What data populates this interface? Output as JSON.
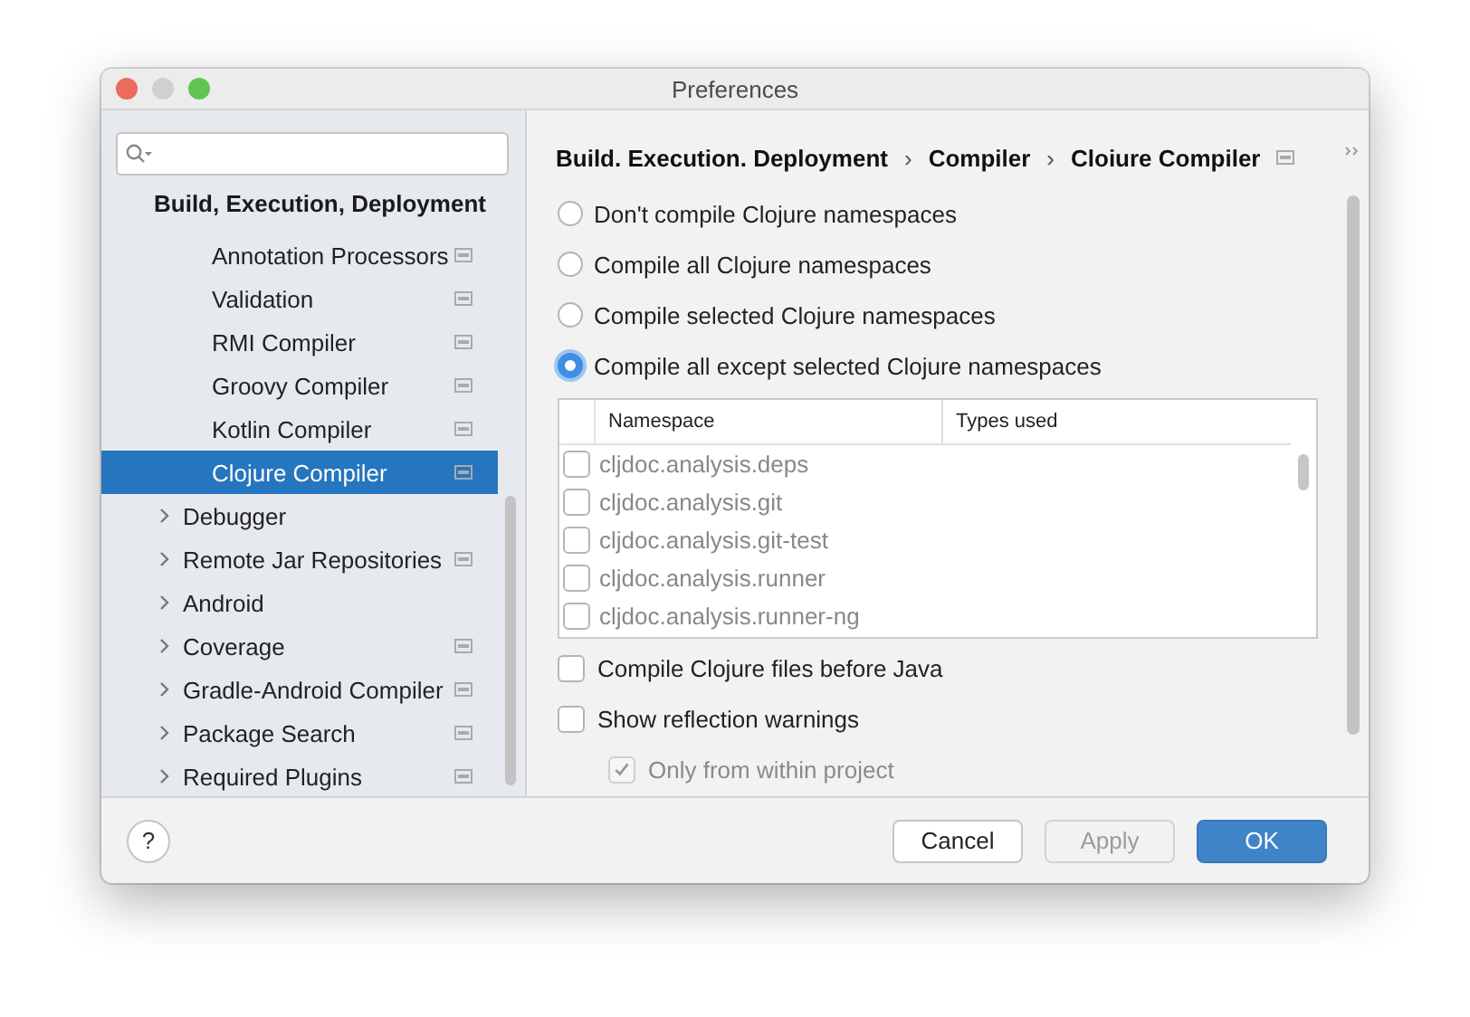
{
  "window": {
    "title": "Preferences"
  },
  "sidebar": {
    "section": {
      "title": "Build, Execution, Deployment",
      "items": [
        {
          "kind": "group",
          "children": [
            {
              "label": "Annotation Processors",
              "project_level": true,
              "selected": false
            },
            {
              "label": "Validation",
              "project_level": true,
              "selected": false
            },
            {
              "label": "RMI Compiler",
              "project_level": true,
              "selected": false
            },
            {
              "label": "Groovy Compiler",
              "project_level": true,
              "selected": false
            },
            {
              "label": "Kotlin Compiler",
              "project_level": true,
              "selected": false
            },
            {
              "label": "Clojure Compiler",
              "project_level": true,
              "selected": true
            }
          ]
        },
        {
          "kind": "node",
          "label": "Debugger",
          "expanded": false,
          "project_level": false,
          "selected": false
        },
        {
          "kind": "node",
          "label": "Remote Jar Repositories",
          "expanded": false,
          "project_level": true,
          "selected": false
        },
        {
          "kind": "node",
          "label": "Android",
          "expanded": false,
          "project_level": false,
          "selected": false
        },
        {
          "kind": "node",
          "label": "Coverage",
          "expanded": false,
          "project_level": true,
          "selected": false
        },
        {
          "kind": "node",
          "label": "Gradle-Android Compiler",
          "expanded": false,
          "project_level": true,
          "selected": false
        },
        {
          "kind": "node",
          "label": "Package Search",
          "expanded": false,
          "project_level": true,
          "selected": false
        },
        {
          "kind": "node",
          "label": "Required Plugins",
          "expanded": false,
          "project_level": true,
          "selected": false
        }
      ]
    }
  },
  "breadcrumb": {
    "parts": [
      "Build. Execution. Deployment",
      "›",
      "Compiler",
      "›",
      "Cloiure Compiler"
    ],
    "project_level": true
  },
  "options": [
    {
      "label": "Don't compile Clojure namespaces",
      "selected": false
    },
    {
      "label": "Compile all Clojure namespaces",
      "selected": false
    },
    {
      "label": "Compile selected Clojure namespaces",
      "selected": false
    },
    {
      "label": "Compile all except selected Clojure namespaces",
      "selected": true
    }
  ],
  "table": {
    "columns": [
      "Namespace",
      "Types used"
    ],
    "rows": [
      {
        "namespace": "cljdoc.analysis.deps",
        "checked": false
      },
      {
        "namespace": "cljdoc.analysis.git",
        "checked": false
      },
      {
        "namespace": "cljdoc.analysis.git-test",
        "checked": false
      },
      {
        "namespace": "cljdoc.analysis.runner",
        "checked": false
      },
      {
        "namespace": "cljdoc.analysis.runner-ng",
        "checked": false
      }
    ]
  },
  "checkboxes": [
    {
      "label": "Compile Clojure files before Java",
      "checked": false,
      "disabled": false,
      "indented": false
    },
    {
      "label": "Show reflection warnings",
      "checked": false,
      "disabled": false,
      "indented": false
    },
    {
      "label": "Only from within project",
      "checked": true,
      "disabled": true,
      "indented": true
    }
  ],
  "help_button": {
    "label": "?"
  },
  "buttons": [
    {
      "label": "Cancel",
      "kind": "normal",
      "disabled": false
    },
    {
      "label": "Apply",
      "kind": "normal",
      "disabled": true
    },
    {
      "label": "OK",
      "kind": "default",
      "disabled": false
    }
  ]
}
